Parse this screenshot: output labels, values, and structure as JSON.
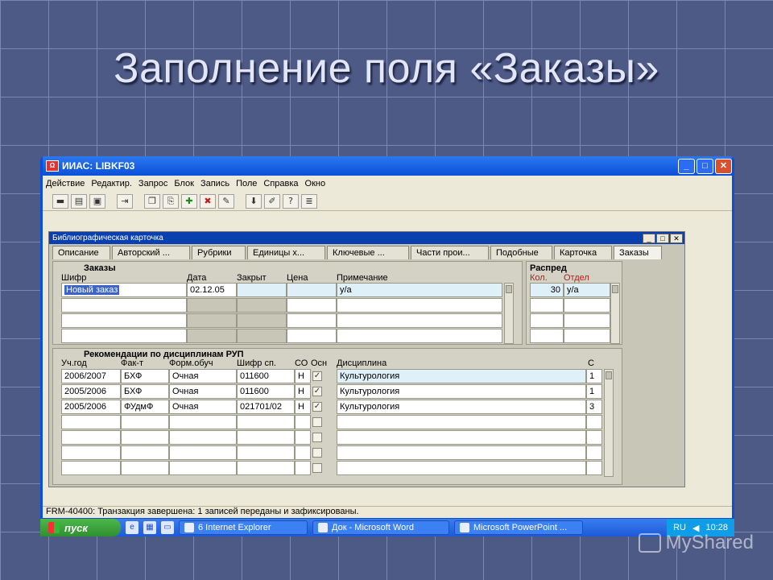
{
  "slide": {
    "title": "Заполнение поля «Заказы»"
  },
  "window": {
    "title": "ИИАС: LIBKF03",
    "controls": [
      "_",
      "□",
      "✕"
    ]
  },
  "menu": [
    "Действие",
    "Редактир.",
    "Запрос",
    "Блок",
    "Запись",
    "Поле",
    "Справка",
    "Окно"
  ],
  "toolbar_icons": [
    "save-icon",
    "print-icon",
    "print-preview-icon",
    "exit-icon",
    "copy-icon",
    "paste-icon",
    "insert-record-icon",
    "delete-record-icon",
    "clear-icon",
    "download-icon",
    "edit-icon",
    "help-icon",
    "list-icon"
  ],
  "inner_window": {
    "title": "Библиографическая карточка",
    "tabs": [
      "Описание",
      "Авторский ...",
      "Рубрики",
      "Единицы х...",
      "Ключевые ...",
      "Части прои...",
      "Подобные",
      "Карточка",
      "Заказы"
    ],
    "active_tab": "Заказы"
  },
  "orders": {
    "section_title": "Заказы",
    "columns": [
      "Шифр",
      "Дата",
      "Закрыт",
      "Цена",
      "Примечание"
    ],
    "row": {
      "code": "Новый заказ",
      "date": "02.12.05",
      "closed": "",
      "price": "",
      "note": "у/а"
    }
  },
  "distribution": {
    "section_title": "Распред",
    "columns": [
      "Кол.",
      "Отдел"
    ],
    "row": {
      "qty": "30",
      "dept": "у/а"
    }
  },
  "recommendations": {
    "section_title": "Рекомендации по дисциплинам РУП",
    "columns": [
      "Уч.год",
      "Фак-т",
      "Форм.обуч",
      "Шифр сп.",
      "СО",
      "Осн",
      "Дисциплина",
      "С"
    ],
    "rows": [
      {
        "year": "2006/2007",
        "faculty": "БХФ",
        "form": "Очная",
        "spec": "011600",
        "co": "Н",
        "main": true,
        "discipline": "Культурология",
        "s": "1"
      },
      {
        "year": "2005/2006",
        "faculty": "БХФ",
        "form": "Очная",
        "spec": "011600",
        "co": "Н",
        "main": true,
        "discipline": "Культурология",
        "s": "1"
      },
      {
        "year": "2005/2006",
        "faculty": "ФУдмФ",
        "form": "Очная",
        "spec": "021701/02",
        "co": "Н",
        "main": true,
        "discipline": "Культурология",
        "s": "3"
      }
    ]
  },
  "status": "FRM-40400: Транзакция завершена: 1 записей переданы и зафиксированы.",
  "taskbar": {
    "start": "пуск",
    "tasks": [
      "6 Internet Explorer",
      "Док - Microsoft Word",
      "Microsoft PowerPoint ..."
    ],
    "lang": "RU",
    "time": "10:28"
  },
  "watermark": "MyShared"
}
